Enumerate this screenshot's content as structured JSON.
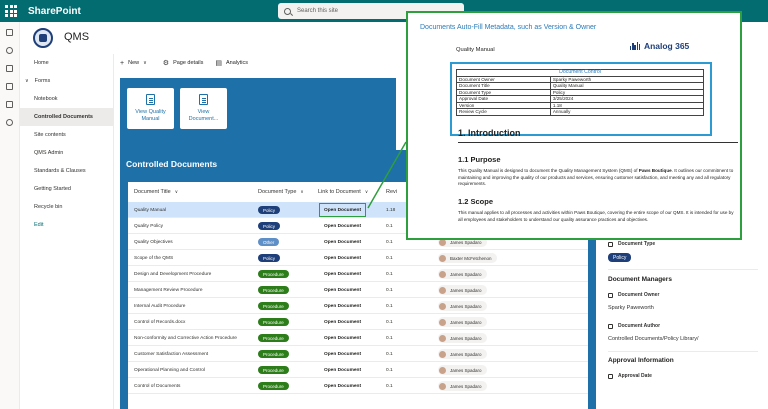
{
  "app": {
    "brand": "SharePoint"
  },
  "search": {
    "placeholder": "Search this site"
  },
  "site": {
    "title": "QMS"
  },
  "nav": {
    "home": "Home",
    "forms": "Forms",
    "notebook": "Notebook",
    "controlled_documents": "Controlled Documents",
    "site_contents": "Site contents",
    "qms_admin": "QMS Admin",
    "standards": "Standards & Clauses",
    "getting_started": "Getting Started",
    "recycle_bin": "Recycle bin",
    "edit": "Edit"
  },
  "commandbar": {
    "new": "New",
    "page_details": "Page details",
    "analytics": "Analytics"
  },
  "quicklinks": [
    {
      "label_line1": "View Quality",
      "label_line2": "Manual"
    },
    {
      "label_line1": "View",
      "label_line2": "Document..."
    }
  ],
  "library": {
    "title": "Controlled Documents",
    "columns": {
      "title": "Document Title",
      "type": "Document Type",
      "link": "Link to Document",
      "rev": "Revi"
    },
    "open_label": "Open Document",
    "rows": [
      {
        "title": "Quality Manual",
        "type": "Policy",
        "rev": "1.18",
        "person": ""
      },
      {
        "title": "Quality Policy",
        "type": "Policy",
        "rev": "0.1",
        "person": ""
      },
      {
        "title": "Quality Objectives",
        "type": "Other",
        "rev": "0.1",
        "person": "James Spadaro"
      },
      {
        "title": "Scope of the QMS",
        "type": "Policy",
        "rev": "0.1",
        "person": "Baxter McFetchenon"
      },
      {
        "title": "Design and Development Procedure",
        "type": "Procedure",
        "rev": "0.1",
        "person": "James Spadaro"
      },
      {
        "title": "Management Review Procedure",
        "type": "Procedure",
        "rev": "0.1",
        "person": "James Spadaro"
      },
      {
        "title": "Internal Audit Procedure",
        "type": "Procedure",
        "rev": "0.1",
        "person": "James Spadaro"
      },
      {
        "title": "Control of Records.docx",
        "type": "Procedure",
        "rev": "0.1",
        "person": "James Spadaro"
      },
      {
        "title": "Non-conformity and Corrective Action Procedure",
        "type": "Procedure",
        "rev": "0.1",
        "person": "James Spadaro"
      },
      {
        "title": "Customer Satisfaction Assessment",
        "type": "Procedure",
        "rev": "0.1",
        "person": "James Spadaro"
      },
      {
        "title": "Operational Planning and Control",
        "type": "Procedure",
        "rev": "0.1",
        "person": "James Spadaro"
      },
      {
        "title": "Control of Documents",
        "type": "Procedure",
        "rev": "0.1",
        "person": "James Spadaro"
      }
    ]
  },
  "details": {
    "doc_type_label": "Document Type",
    "doc_type_value": "Policy",
    "managers_heading": "Document Managers",
    "owner_label": "Document Owner",
    "owner_value": "Sparky Paweworth",
    "author_label": "Document Author",
    "author_value": "Controlled Documents/Policy Library/",
    "approval_heading": "Approval Information",
    "approval_date_label": "Approval Date"
  },
  "callout": {
    "caption": "Documents Auto-Fill Metadata, such as Version & Owner",
    "doc_header": "Quality Manual",
    "logo_text": "Analog 365",
    "control_title": "Document Control",
    "control_rows": [
      {
        "k": "Document Owner",
        "v": "Sparky Paweworth"
      },
      {
        "k": "Document Title",
        "v": "Quality Manual"
      },
      {
        "k": "Document Type",
        "v": "Policy"
      },
      {
        "k": "Approval Date",
        "v": "3/25/2024"
      },
      {
        "k": "Version",
        "v": "1.18"
      },
      {
        "k": "Review Cycle",
        "v": "Annually"
      }
    ],
    "h1": "1.   Introduction",
    "s11_title": "1.1     Purpose",
    "s11_text_a": "This Quality Manual is designed to document the Quality Management System (QMS) of ",
    "s11_bold": "Paws Boutique",
    "s11_text_b": ". It outlines our commitment to maintaining and improving the quality of our products and services, ensuring customer satisfaction, and meeting any and all regulatory requirements.",
    "s12_title": "1.2     Scope",
    "s12_text": "This manual applies to all processes and activities within Paws Boutique, covering the entire scope of our QMS. It is intended for use by all employees and stakeholders to understand our quality assurance practices and objectives."
  },
  "colors": {
    "suite_bar": "#036c70",
    "hero_blue": "#1e70a8",
    "policy_badge": "#1e3f7a",
    "procedure_badge": "#2e7d1b",
    "other_badge": "#5f8fc7",
    "callout_border": "#2e9f3d",
    "control_box": "#2b9bd1"
  }
}
